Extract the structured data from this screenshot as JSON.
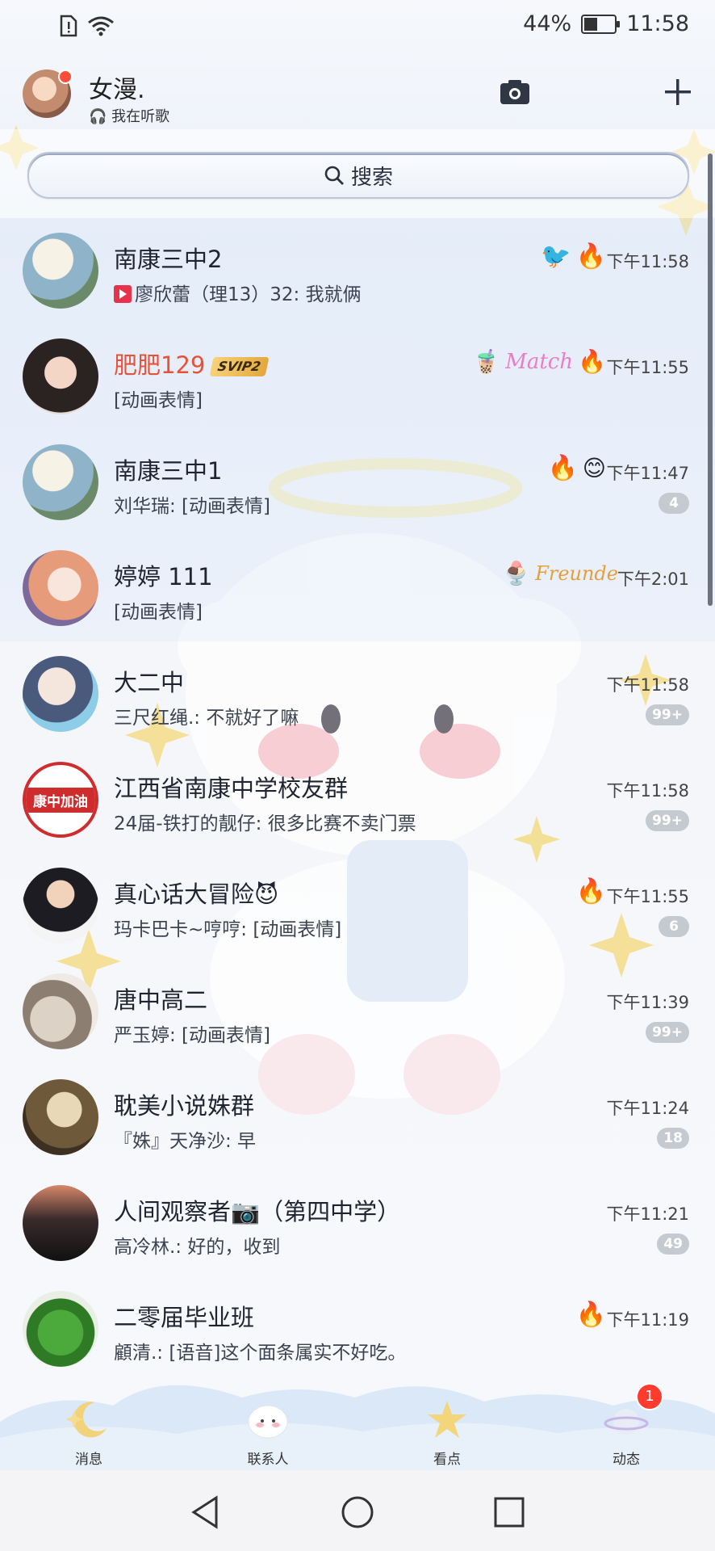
{
  "status_bar": {
    "battery_percent": "44%",
    "battery_level": 0.44,
    "time": "11:58"
  },
  "header": {
    "name": "女漫.",
    "status": "我在听歌"
  },
  "search": {
    "label": "搜索"
  },
  "conversations": [
    {
      "title": "南康三中2",
      "preview_icon": "video-icon",
      "preview": "廖欣蕾（理13）32: 我就俩",
      "time": "下午11:58",
      "badge": ""
    },
    {
      "title": "肥肥129",
      "vip": "SVIP2",
      "preview": "[动画表情]",
      "time": "下午11:55",
      "badge": ""
    },
    {
      "title": "南康三中1",
      "preview": "刘华瑞: [动画表情]",
      "time": "下午11:47",
      "badge": "4"
    },
    {
      "title": "婷婷 111",
      "preview": "[动画表情]",
      "time": "下午2:01",
      "badge": ""
    },
    {
      "title": "大二中",
      "preview": "三尺红绳.: 不就好了嘛",
      "time": "下午11:58",
      "badge": "99+"
    },
    {
      "title": "江西省南康中学校友群",
      "preview": "24届-铁打的靓仔: 很多比赛不卖门票",
      "time": "下午11:58",
      "badge": "99+",
      "avatar_text": "康中加油"
    },
    {
      "title": "真心话大冒险😈",
      "preview": "玛卡巴卡~哼哼: [动画表情]",
      "time": "下午11:55",
      "badge": "6"
    },
    {
      "title": "唐中高二",
      "preview": "严玉婷: [动画表情]",
      "time": "下午11:39",
      "badge": "99+"
    },
    {
      "title": "耽美小说姝群",
      "preview": "『姝』天净沙: 早",
      "time": "下午11:24",
      "badge": "18"
    },
    {
      "title": "人间观察者📷（第四中学）",
      "preview": "高冷林.: 好的，收到",
      "time": "下午11:21",
      "badge": "49"
    },
    {
      "title": "二零届毕业班",
      "preview": "顧清.: [语音]这个面条属实不好吃。",
      "time": "下午11:19",
      "badge": ""
    }
  ],
  "bottom_nav": [
    {
      "label": "消息",
      "icon": "moon-icon"
    },
    {
      "label": "联系人",
      "icon": "lamb-icon"
    },
    {
      "label": "看点",
      "icon": "star-icon"
    },
    {
      "label": "动态",
      "icon": "planet-icon",
      "badge": "1"
    }
  ],
  "colors": {
    "accent_red": "#e5533a",
    "badge_gray": "#c5c9d0",
    "nav_badge": "#ff3b30"
  }
}
